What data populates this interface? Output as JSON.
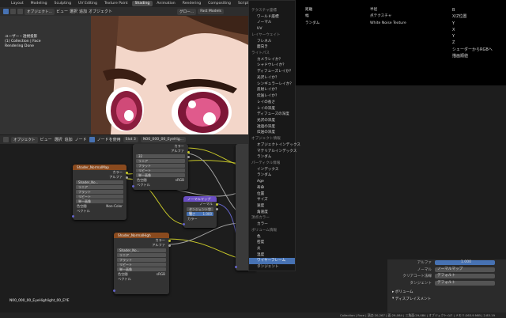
{
  "workspace_tabs": [
    "Layout",
    "Modeling",
    "Sculpting",
    "UV Editing",
    "Texture Paint",
    "Shading",
    "Animation",
    "Rendering",
    "Compositing",
    "Scripting"
  ],
  "active_tab": "Shading",
  "viewport": {
    "mode": "オブジェクト...",
    "view": "ビュー",
    "select": "選択",
    "add": "追加",
    "object": "オブジェクト",
    "transform": "グロー...",
    "shading_label": "Fast Models",
    "info_title": "ユーザー・透視投影",
    "info_collection": "(1) Collection | Face",
    "info_status": "Rendering Done"
  },
  "node_editor": {
    "mode": "オブジェクト",
    "view": "ビュー",
    "select": "選択",
    "add": "追加",
    "node": "ノード",
    "use_nodes": "ノードを使用",
    "slot": "Slot 3",
    "material": "N00_000_00_EyeHig...",
    "nodename": "N00_000_00_EyeHighlight_00_EYE"
  },
  "nodes": {
    "tex1": {
      "title": "Shader_NormalMap",
      "tex": "Shader_No...",
      "rows": [
        "リニア",
        "フラット",
        "リピート",
        "単一画像"
      ],
      "color_space": "色空間",
      "cs_val": "Non-Color",
      "alpha": "アルファ",
      "out_color": "カラー",
      "out_alpha": "アルファ",
      "vector": "ベクトル"
    },
    "tex2": {
      "title": "Shader_NormalHigh",
      "tex": "Shader_No...",
      "rows": [
        "リニア",
        "フラット",
        "リピート",
        "単一画像"
      ],
      "color_space": "色空間",
      "cs_val": "sRGB",
      "vector": "ベクトル",
      "out_color": "カラー",
      "out_alpha": "アルファ"
    },
    "tex3": {
      "rows": [
        "リニア",
        "フラット",
        "リピート",
        "単一画像"
      ],
      "color_space": "色空間",
      "cs_val": "sRGB",
      "vector": "ベクトル",
      "out_color": "カラー",
      "out_alpha": "アルファ",
      "field": "32"
    },
    "normal": {
      "title": "ノーマルマップ",
      "out": "ノーマル",
      "space": "タンジェント空間",
      "strength_label": "強さ",
      "strength": "1.000",
      "color": "カラー"
    }
  },
  "menu": {
    "sections": [
      "テクスチャ座標",
      "",
      "",
      "",
      "",
      "ライトパス",
      "",
      "",
      "",
      "",
      "",
      "",
      "",
      "",
      "",
      "",
      "",
      "",
      "",
      "オブジェクト情報",
      "",
      "",
      "",
      "",
      "",
      "",
      "",
      "",
      "",
      "",
      "ボリューム情報",
      "",
      "",
      "",
      "",
      "",
      ""
    ],
    "items": [
      {
        "label": "テクスチャ座標",
        "kind": "head"
      },
      {
        "label": "ワールド座標",
        "kind": "item"
      },
      {
        "label": "ノーマル",
        "kind": "item"
      },
      {
        "label": "UV",
        "kind": "item"
      },
      {
        "label": "レイヤーウェイト",
        "kind": "head"
      },
      {
        "label": "フレネル",
        "kind": "item"
      },
      {
        "label": "面向き",
        "kind": "item"
      },
      {
        "label": "ライトパス",
        "kind": "head"
      },
      {
        "label": "カメラレイか？",
        "kind": "item"
      },
      {
        "label": "シャドウレイか？",
        "kind": "item"
      },
      {
        "label": "ディフューズレイか？",
        "kind": "item"
      },
      {
        "label": "光沢レイか？",
        "kind": "item"
      },
      {
        "label": "シンギュラーレイか？",
        "kind": "item"
      },
      {
        "label": "反射レイか？",
        "kind": "item"
      },
      {
        "label": "伝送レイか？",
        "kind": "item"
      },
      {
        "label": "レイの長さ",
        "kind": "item"
      },
      {
        "label": "レイの深度",
        "kind": "item"
      },
      {
        "label": "ディフューズの深度",
        "kind": "item"
      },
      {
        "label": "光沢の深度",
        "kind": "item"
      },
      {
        "label": "透過の深度",
        "kind": "item"
      },
      {
        "label": "伝送の深度",
        "kind": "item"
      },
      {
        "label": "オブジェクト情報",
        "kind": "head"
      },
      {
        "label": "オブジェクトインデックス",
        "kind": "item"
      },
      {
        "label": "マテリアルインデックス",
        "kind": "item"
      },
      {
        "label": "ランダム",
        "kind": "item"
      },
      {
        "label": "パーティクル情報",
        "kind": "head"
      },
      {
        "label": "インデックス",
        "kind": "item"
      },
      {
        "label": "ランダム",
        "kind": "item"
      },
      {
        "label": "Age",
        "kind": "item"
      },
      {
        "label": "寿命",
        "kind": "item"
      },
      {
        "label": "位置",
        "kind": "item"
      },
      {
        "label": "サイズ",
        "kind": "item"
      },
      {
        "label": "速度",
        "kind": "item"
      },
      {
        "label": "角速度",
        "kind": "item"
      },
      {
        "label": "頂点カラー",
        "kind": "head"
      },
      {
        "label": "カラー",
        "kind": "item"
      },
      {
        "label": "ボリューム情報",
        "kind": "head"
      },
      {
        "label": "色",
        "kind": "item"
      },
      {
        "label": "密度",
        "kind": "item"
      },
      {
        "label": "炎",
        "kind": "item"
      },
      {
        "label": "温度",
        "kind": "item"
      },
      {
        "label": "ワイヤーフレーム",
        "kind": "item",
        "highlight": true
      },
      {
        "label": "タンジェント",
        "kind": "item"
      }
    ]
  },
  "submenu": {
    "col1": [
      "距離",
      "幅",
      "ランダム",
      "",
      "",
      "",
      "",
      "",
      "",
      "",
      "",
      "",
      ""
    ],
    "col2": [
      "半径",
      "点テクスチャ",
      "White Noise Texture"
    ],
    "col3": [
      "B",
      "X/Z位置",
      "Y",
      "X",
      "Y",
      "Z",
      "シェーダーからRGBへ",
      "描画順値"
    ]
  },
  "properties": {
    "alpha_label": "アルファ",
    "alpha": "1.000",
    "normal_label": "ノーマル",
    "normal": "ノーマルマップ",
    "clearcoat_label": "クリアコート法線",
    "clearcoat": "デフォルト",
    "tangent_label": "タンジェント",
    "tangent": "デフォルト",
    "volume": "ボリューム",
    "displacement": "ディスプレイスメント"
  },
  "status": "Collection | Face | 頂点:20,267 | 面:29,084 | 三角面:29,084 | オブジェクト:0/7 | メモリ:263.9 MiB | 2.83.19",
  "colors": {
    "accent": "#4772b3",
    "tex_header": "#8a4a1e",
    "vec_header": "#6b4fc4",
    "socket_yellow": "#c7c729",
    "socket_blue": "#6363c7",
    "socket_gray": "#a1a1a1"
  }
}
